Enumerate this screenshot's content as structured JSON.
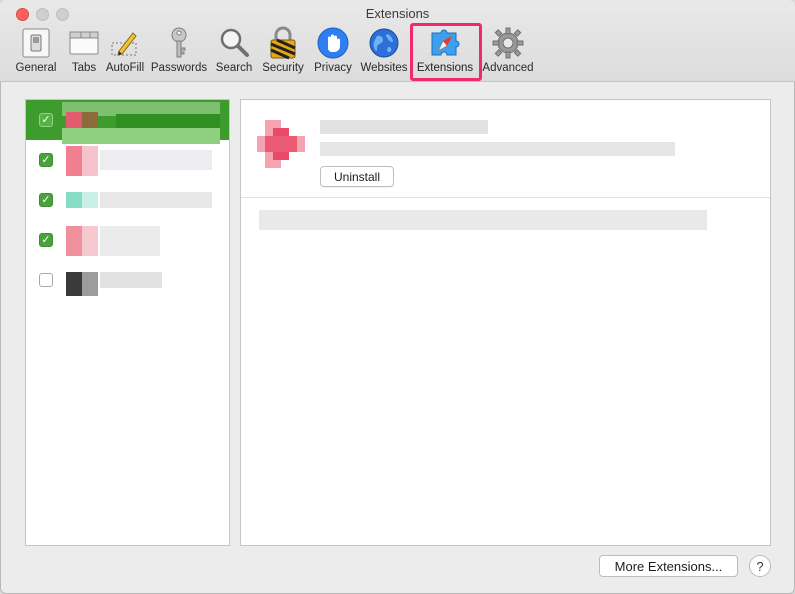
{
  "window": {
    "title": "Extensions"
  },
  "toolbar": {
    "items": [
      {
        "label": "General",
        "icon": "general-switch-icon"
      },
      {
        "label": "Tabs",
        "icon": "tabs-icon"
      },
      {
        "label": "AutoFill",
        "icon": "autofill-pencil-icon"
      },
      {
        "label": "Passwords",
        "icon": "key-icon"
      },
      {
        "label": "Search",
        "icon": "magnifier-icon"
      },
      {
        "label": "Security",
        "icon": "lock-icon"
      },
      {
        "label": "Privacy",
        "icon": "hand-icon"
      },
      {
        "label": "Websites",
        "icon": "globe-icon"
      },
      {
        "label": "Extensions",
        "icon": "puzzle-compass-icon"
      },
      {
        "label": "Advanced",
        "icon": "gear-icon"
      }
    ],
    "active": "Extensions",
    "highlight_color": "#f2286e"
  },
  "extensions_list": {
    "items": [
      {
        "enabled": true,
        "selected": true
      },
      {
        "enabled": true,
        "selected": false
      },
      {
        "enabled": true,
        "selected": false
      },
      {
        "enabled": true,
        "selected": false
      },
      {
        "enabled": false,
        "selected": false
      }
    ],
    "check_glyph": "✓",
    "selected_color": "#3e9c2f"
  },
  "detail": {
    "uninstall_label": "Uninstall"
  },
  "footer": {
    "more_extensions_label": "More Extensions...",
    "help_label": "?"
  }
}
